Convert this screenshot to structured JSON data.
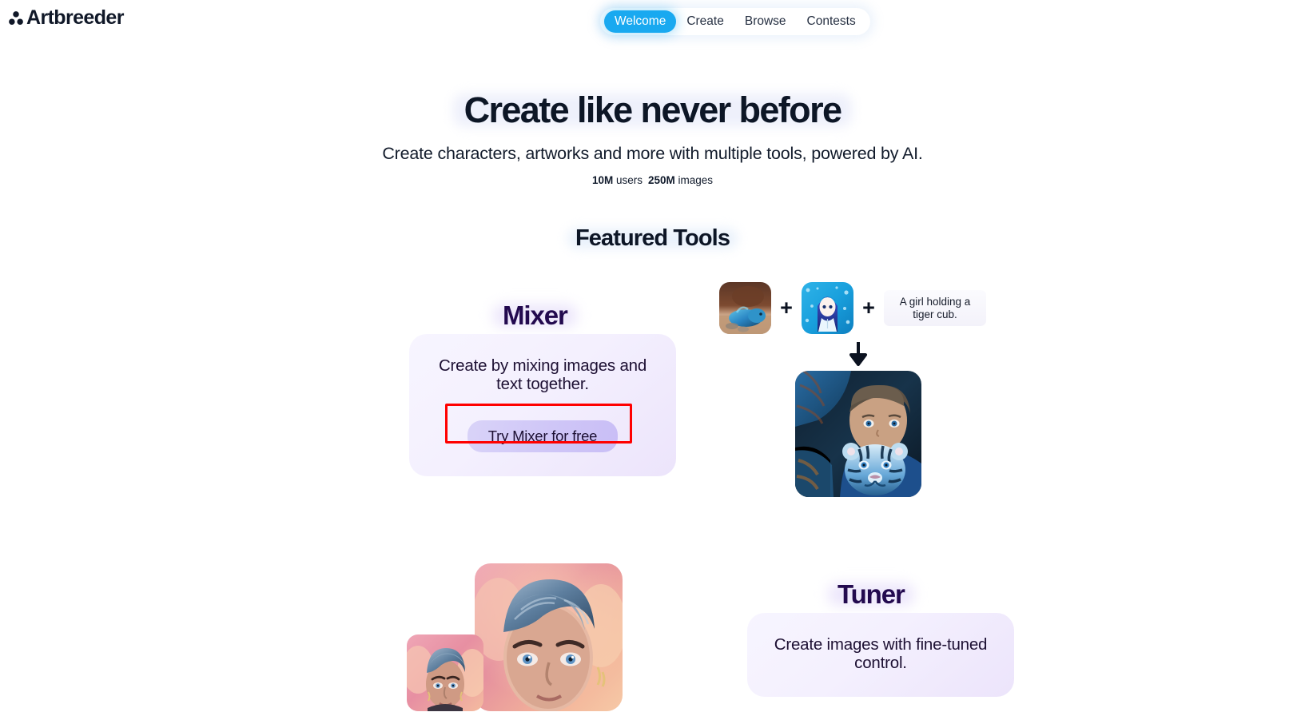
{
  "brand": {
    "name": "Artbreeder",
    "logo_icon": "three-circles-icon"
  },
  "nav": {
    "items": [
      {
        "label": "Welcome",
        "active": true
      },
      {
        "label": "Create",
        "active": false
      },
      {
        "label": "Browse",
        "active": false
      },
      {
        "label": "Contests",
        "active": false
      }
    ],
    "active_color": "#19A9F0"
  },
  "hero": {
    "title": "Create like never before",
    "subtitle": "Create characters, artworks and more with multiple tools, powered by AI.",
    "stats": {
      "users_value": "10M",
      "users_label": "users",
      "images_value": "250M",
      "images_label": "images"
    }
  },
  "featured": {
    "title": "Featured Tools"
  },
  "tools": [
    {
      "name": "Mixer",
      "description": "Create by mixing images and text together.",
      "cta_label": "Try Mixer for free",
      "cta_highlighted": true,
      "illustration": {
        "inputs": [
          {
            "icon": "blue-dragon-thumbnail"
          },
          {
            "icon": "anime-girl-thumbnail"
          }
        ],
        "operator": "+",
        "prompt": "A girl holding a tiger cub.",
        "arrow_icon": "arrow-down-icon",
        "result": {
          "icon": "girl-with-blue-tiger-cub-image"
        }
      }
    },
    {
      "name": "Tuner",
      "description": "Create images with fine-tuned control.",
      "illustration": {
        "images": [
          {
            "icon": "blue-haired-character-large"
          },
          {
            "icon": "blue-haired-character-small"
          }
        ]
      }
    }
  ],
  "colors": {
    "accent_blue": "#19A9F0",
    "heading_purple": "#230A4F",
    "card_background": "#F4F0FE",
    "cta_background": "#CFC6F7",
    "highlight_red": "#FF0000",
    "page_background": "#FFFFFF"
  }
}
